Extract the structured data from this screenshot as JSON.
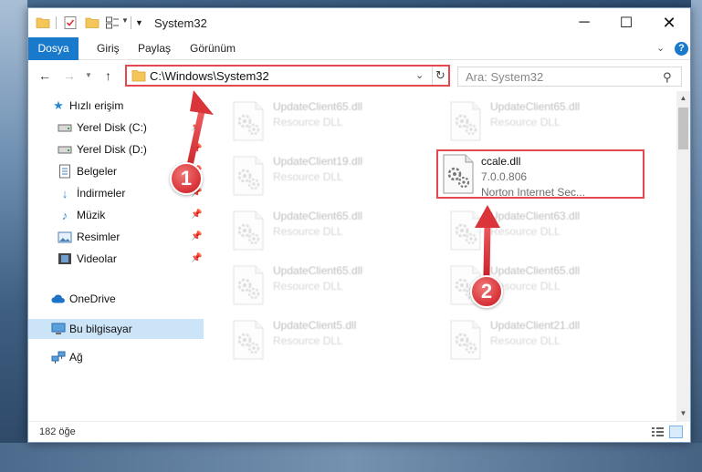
{
  "window": {
    "title": "System32",
    "controls": {
      "minimize": "─",
      "maximize": "☐",
      "close": "✕"
    }
  },
  "ribbon": {
    "tabs": [
      {
        "label": "Dosya",
        "active": true
      },
      {
        "label": "Giriş"
      },
      {
        "label": "Paylaş"
      },
      {
        "label": "Görünüm"
      }
    ],
    "expand_icon": "chevron-down-icon",
    "help_label": "?"
  },
  "navbar": {
    "address": "C:\\Windows\\System32",
    "search_placeholder": "Ara: System32"
  },
  "sidebar": {
    "items": [
      {
        "label": "Hızlı erişim",
        "icon": "star-icon",
        "level": 0,
        "pinned": false
      },
      {
        "label": "Yerel Disk (C:)",
        "icon": "drive-icon",
        "level": 1,
        "pinned": true
      },
      {
        "label": "Yerel Disk (D:)",
        "icon": "drive-icon",
        "level": 1,
        "pinned": true
      },
      {
        "label": "Belgeler",
        "icon": "document-icon",
        "level": 1,
        "pinned": true
      },
      {
        "label": "İndirmeler",
        "icon": "download-icon",
        "level": 1,
        "pinned": true
      },
      {
        "label": "Müzik",
        "icon": "music-icon",
        "level": 1,
        "pinned": true
      },
      {
        "label": "Resimler",
        "icon": "pictures-icon",
        "level": 1,
        "pinned": true
      },
      {
        "label": "Videolar",
        "icon": "video-icon",
        "level": 1,
        "pinned": true
      },
      {
        "label": "OneDrive",
        "icon": "cloud-icon",
        "level": 0,
        "pinned": false
      },
      {
        "label": "Bu bilgisayar",
        "icon": "computer-icon",
        "level": 0,
        "pinned": false,
        "selected": true
      },
      {
        "label": "Ağ",
        "icon": "network-icon",
        "level": 0,
        "pinned": false
      }
    ]
  },
  "files": [
    {
      "name": "UpdateClient65.dll",
      "line2": "Resource DLL",
      "line3": "",
      "faded": true
    },
    {
      "name": "UpdateClient65.dll",
      "line2": "Resource DLL",
      "line3": "",
      "faded": true
    },
    {
      "name": "UpdateClient19.dll",
      "line2": "Resource DLL",
      "line3": "",
      "faded": true
    },
    {
      "name": "ccale.dll",
      "line2": "7.0.0.806",
      "line3": "Norton Internet Sec...",
      "faded": false,
      "highlighted": true
    },
    {
      "name": "UpdateClient65.dll",
      "line2": "Resource DLL",
      "line3": "",
      "faded": true
    },
    {
      "name": "UpdateClient63.dll",
      "line2": "Resource DLL",
      "line3": "",
      "faded": true
    },
    {
      "name": "UpdateClient65.dll",
      "line2": "Resource DLL",
      "line3": "",
      "faded": true
    },
    {
      "name": "UpdateClient65.dll",
      "line2": "Resource DLL",
      "line3": "",
      "faded": true
    },
    {
      "name": "UpdateClient5.dll",
      "line2": "Resource DLL",
      "line3": "",
      "faded": true
    },
    {
      "name": "UpdateClient21.dll",
      "line2": "Resource DLL",
      "line3": "",
      "faded": true
    }
  ],
  "status": {
    "item_count": "182 öğe"
  },
  "callouts": [
    {
      "label": "1"
    },
    {
      "label": "2"
    }
  ],
  "colors": {
    "accent": "#1979ca",
    "highlight": "#e5484d",
    "selected_bg": "#cce4f7"
  }
}
